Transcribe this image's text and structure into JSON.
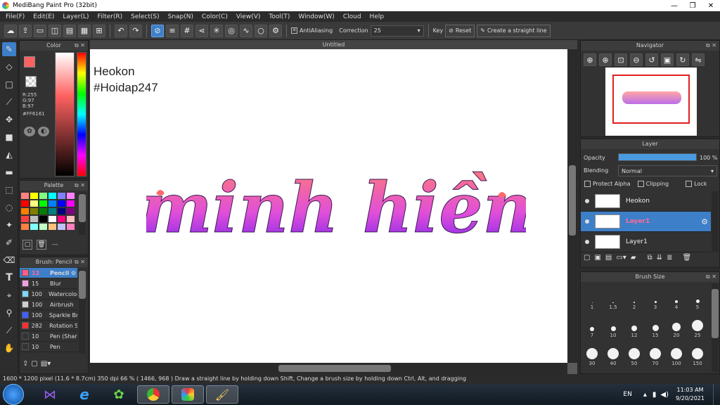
{
  "window": {
    "title": "MediBang Paint Pro (32bit)",
    "minimize": "—",
    "maximize": "❐",
    "close": "✕"
  },
  "menu": [
    "File(F)",
    "Edit(E)",
    "Layer(L)",
    "Filter(R)",
    "Select(S)",
    "Snap(N)",
    "Color(C)",
    "View(V)",
    "Tool(T)",
    "Window(W)",
    "Cloud",
    "Help"
  ],
  "toolbar": {
    "antialiasing_label": "AntiAliasing",
    "correction_label": "Correction",
    "correction_value": "25",
    "key_label": "Key",
    "reset_label": "Reset",
    "straight_line_label": "Create a straight line"
  },
  "color_panel": {
    "title": "Color",
    "r": "R:255",
    "g": "G:97",
    "b": "B:97",
    "hex": "#FF6161",
    "primary": "#ff6161",
    "secondary": "#ff8c1a"
  },
  "palette_panel": {
    "title": "Palette",
    "swatches": [
      "#ff8080",
      "#ffff00",
      "#80ff80",
      "#00ffff",
      "#8080ff",
      "#ff80ff",
      "#ff0000",
      "#ffff80",
      "#00ff00",
      "#0080ff",
      "#0000ff",
      "#ff00ff",
      "#ff8000",
      "#808000",
      "#008000",
      "#008080",
      "#000080",
      "#800080",
      "#ff4040",
      "#c0c0c0",
      "#000000",
      "#ffffff",
      "#ff0080",
      "#ffc0c0",
      "#ff8040",
      "#80ffff",
      "#c0ffc0",
      "#ffc080",
      "#c0c0ff",
      "#ff80c0"
    ],
    "footer_label": "---"
  },
  "brush_panel": {
    "title": "Brush: Pencil",
    "items": [
      {
        "size": "12",
        "name": "Pencil",
        "color": "#ff5c8a",
        "selected": true
      },
      {
        "size": "15",
        "name": "Blur",
        "color": "#f0a0e0"
      },
      {
        "size": "100",
        "name": "Watercolor",
        "color": "#7fd6ff"
      },
      {
        "size": "100",
        "name": "Airbrush",
        "color": "#d0d0d0"
      },
      {
        "size": "100",
        "name": "Sparkle Br",
        "color": "#4060ff"
      },
      {
        "size": "282",
        "name": "Rotation S",
        "color": "#ff3030"
      },
      {
        "size": "10",
        "name": "Pen (Shar",
        "color": "#333333"
      },
      {
        "size": "10",
        "name": "Pen",
        "color": "#333333"
      }
    ]
  },
  "canvas": {
    "tab_title": "Untitled",
    "text_line1": "Heokon",
    "text_line2": "#Hoidap247",
    "lettering": "minh hiền"
  },
  "navigator": {
    "title": "Navigator"
  },
  "layer_panel": {
    "title": "Layer",
    "opacity_label": "Opacity",
    "opacity_value": "100 %",
    "opacity_fraction": 1.0,
    "blending_label": "Blending",
    "blending_value": "Normal",
    "protect_alpha": "Protect Alpha",
    "clipping": "Clipping",
    "lock": "Lock",
    "layers": [
      {
        "name": "Heokon",
        "selected": false
      },
      {
        "name": "Layer1",
        "selected": true
      },
      {
        "name": "Layer1",
        "selected": false
      }
    ]
  },
  "brush_size_panel": {
    "title": "Brush Size",
    "sizes": [
      "1",
      "1.5",
      "2",
      "3",
      "4",
      "5",
      "7",
      "10",
      "12",
      "15",
      "20",
      "25",
      "30",
      "40",
      "50",
      "70",
      "100",
      "150"
    ]
  },
  "status": {
    "text": "1600 * 1200 pixel  (11.6 * 8.7cm)  350 dpi  66 %  ( 1466, 968 )  Draw a straight line by holding down Shift, Change a brush size by holding down Ctrl, Alt, and dragging"
  },
  "taskbar": {
    "lang": "EN",
    "time": "11:03 AM",
    "date": "9/20/2021"
  }
}
